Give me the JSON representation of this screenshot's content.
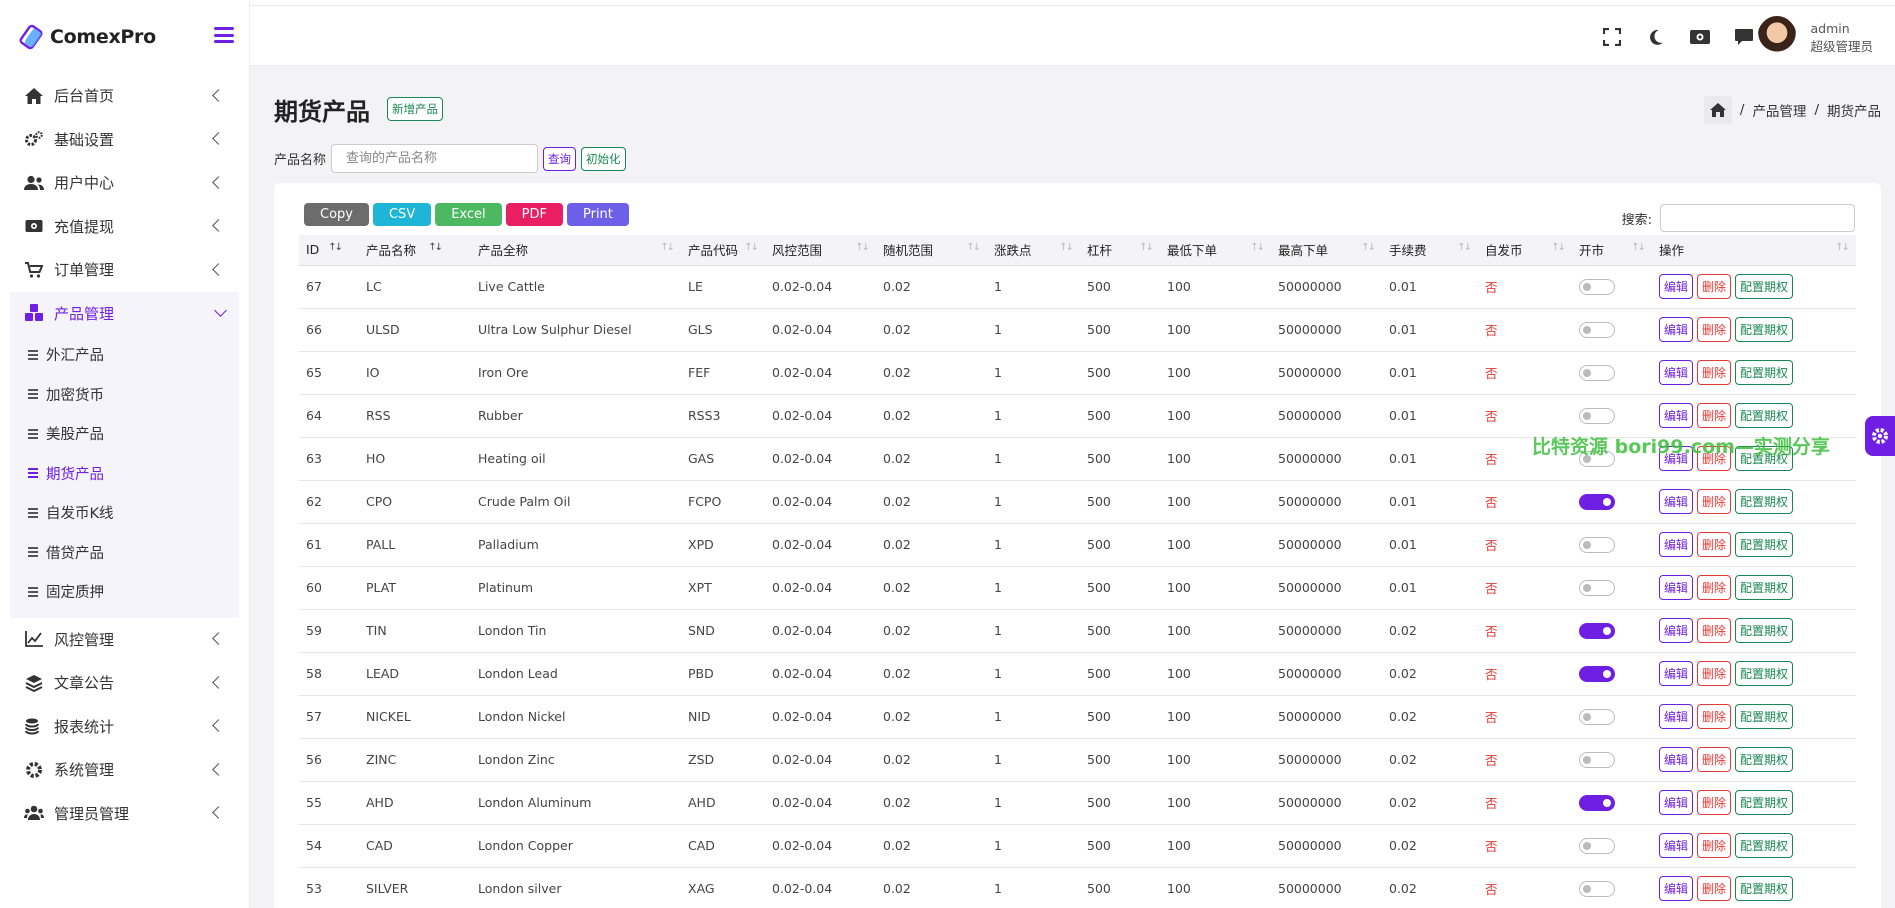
{
  "app": {
    "name": "ComexPro"
  },
  "sidebar": {
    "items": [
      {
        "label": "后台首页",
        "icon": "home-icon"
      },
      {
        "label": "基础设置",
        "icon": "gears-icon"
      },
      {
        "label": "用户中心",
        "icon": "users-icon"
      },
      {
        "label": "充值提现",
        "icon": "money-icon"
      },
      {
        "label": "订单管理",
        "icon": "cart-icon"
      },
      {
        "label": "产品管理",
        "icon": "cubes-icon",
        "active": true
      },
      {
        "label": "风控管理",
        "icon": "chart-line-icon"
      },
      {
        "label": "文章公告",
        "icon": "layers-icon"
      },
      {
        "label": "报表统计",
        "icon": "coins-icon"
      },
      {
        "label": "系统管理",
        "icon": "cog-icon"
      },
      {
        "label": "管理员管理",
        "icon": "user-group-icon"
      }
    ],
    "sub_items": [
      "外汇产品",
      "加密货币",
      "美股产品",
      "期货产品",
      "自发币K线",
      "借贷产品",
      "固定质押"
    ],
    "current_sub": "期货产品"
  },
  "topbar": {
    "icons": [
      "fullscreen-icon",
      "moon-icon",
      "money-icon",
      "chat-icon"
    ],
    "user": {
      "name": "admin",
      "role": "超级管理员"
    }
  },
  "page": {
    "title": "期货产品",
    "add_button": "新增产品",
    "breadcrumb": [
      "产品管理",
      "期货产品"
    ]
  },
  "filter": {
    "label": "产品名称",
    "placeholder": "查询的产品名称",
    "query_button": "查询",
    "reset_button": "初始化"
  },
  "export": {
    "buttons": [
      {
        "label": "Copy",
        "color": "#6c6c6c"
      },
      {
        "label": "CSV",
        "color": "#1fb5d6"
      },
      {
        "label": "Excel",
        "color": "#4cb962"
      },
      {
        "label": "PDF",
        "color": "#e91e63"
      },
      {
        "label": "Print",
        "color": "#6d5fe8"
      }
    ]
  },
  "search": {
    "label": "搜索:"
  },
  "table": {
    "columns": [
      "ID",
      "产品名称",
      "产品全称",
      "产品代码",
      "风控范围",
      "随机范围",
      "涨跌点",
      "杠杆",
      "最低下单",
      "最高下单",
      "手续费",
      "自发币",
      "开市",
      "操作"
    ],
    "ops": {
      "edit": "编辑",
      "delete": "删除",
      "config": "配置期权"
    },
    "rows": [
      {
        "id": "67",
        "name": "LC",
        "full": "Live Cattle",
        "code": "LE",
        "risk": "0.02-0.04",
        "rand": "0.02",
        "pts": "1",
        "lev": "500",
        "min": "100",
        "max": "50000000",
        "fee": "0.01",
        "self": "否",
        "open": false
      },
      {
        "id": "66",
        "name": "ULSD",
        "full": "Ultra Low Sulphur Diesel",
        "code": "GLS",
        "risk": "0.02-0.04",
        "rand": "0.02",
        "pts": "1",
        "lev": "500",
        "min": "100",
        "max": "50000000",
        "fee": "0.01",
        "self": "否",
        "open": false
      },
      {
        "id": "65",
        "name": "IO",
        "full": "Iron Ore",
        "code": "FEF",
        "risk": "0.02-0.04",
        "rand": "0.02",
        "pts": "1",
        "lev": "500",
        "min": "100",
        "max": "50000000",
        "fee": "0.01",
        "self": "否",
        "open": false
      },
      {
        "id": "64",
        "name": "RSS",
        "full": "Rubber",
        "code": "RSS3",
        "risk": "0.02-0.04",
        "rand": "0.02",
        "pts": "1",
        "lev": "500",
        "min": "100",
        "max": "50000000",
        "fee": "0.01",
        "self": "否",
        "open": false
      },
      {
        "id": "63",
        "name": "HO",
        "full": "Heating oil",
        "code": "GAS",
        "risk": "0.02-0.04",
        "rand": "0.02",
        "pts": "1",
        "lev": "500",
        "min": "100",
        "max": "50000000",
        "fee": "0.01",
        "self": "否",
        "open": false
      },
      {
        "id": "62",
        "name": "CPO",
        "full": "Crude Palm Oil",
        "code": "FCPO",
        "risk": "0.02-0.04",
        "rand": "0.02",
        "pts": "1",
        "lev": "500",
        "min": "100",
        "max": "50000000",
        "fee": "0.01",
        "self": "否",
        "open": true
      },
      {
        "id": "61",
        "name": "PALL",
        "full": "Palladium",
        "code": "XPD",
        "risk": "0.02-0.04",
        "rand": "0.02",
        "pts": "1",
        "lev": "500",
        "min": "100",
        "max": "50000000",
        "fee": "0.01",
        "self": "否",
        "open": false
      },
      {
        "id": "60",
        "name": "PLAT",
        "full": "Platinum",
        "code": "XPT",
        "risk": "0.02-0.04",
        "rand": "0.02",
        "pts": "1",
        "lev": "500",
        "min": "100",
        "max": "50000000",
        "fee": "0.01",
        "self": "否",
        "open": false
      },
      {
        "id": "59",
        "name": "TIN",
        "full": "London Tin",
        "code": "SND",
        "risk": "0.02-0.04",
        "rand": "0.02",
        "pts": "1",
        "lev": "500",
        "min": "100",
        "max": "50000000",
        "fee": "0.02",
        "self": "否",
        "open": true
      },
      {
        "id": "58",
        "name": "LEAD",
        "full": "London Lead",
        "code": "PBD",
        "risk": "0.02-0.04",
        "rand": "0.02",
        "pts": "1",
        "lev": "500",
        "min": "100",
        "max": "50000000",
        "fee": "0.02",
        "self": "否",
        "open": true
      },
      {
        "id": "57",
        "name": "NICKEL",
        "full": "London Nickel",
        "code": "NID",
        "risk": "0.02-0.04",
        "rand": "0.02",
        "pts": "1",
        "lev": "500",
        "min": "100",
        "max": "50000000",
        "fee": "0.02",
        "self": "否",
        "open": false
      },
      {
        "id": "56",
        "name": "ZINC",
        "full": "London Zinc",
        "code": "ZSD",
        "risk": "0.02-0.04",
        "rand": "0.02",
        "pts": "1",
        "lev": "500",
        "min": "100",
        "max": "50000000",
        "fee": "0.02",
        "self": "否",
        "open": false
      },
      {
        "id": "55",
        "name": "AHD",
        "full": "London Aluminum",
        "code": "AHD",
        "risk": "0.02-0.04",
        "rand": "0.02",
        "pts": "1",
        "lev": "500",
        "min": "100",
        "max": "50000000",
        "fee": "0.02",
        "self": "否",
        "open": true
      },
      {
        "id": "54",
        "name": "CAD",
        "full": "London Copper",
        "code": "CAD",
        "risk": "0.02-0.04",
        "rand": "0.02",
        "pts": "1",
        "lev": "500",
        "min": "100",
        "max": "50000000",
        "fee": "0.02",
        "self": "否",
        "open": false
      },
      {
        "id": "53",
        "name": "SILVER",
        "full": "London silver",
        "code": "XAG",
        "risk": "0.02-0.04",
        "rand": "0.02",
        "pts": "1",
        "lev": "500",
        "min": "100",
        "max": "50000000",
        "fee": "0.02",
        "self": "否",
        "open": false
      }
    ]
  },
  "watermark": "比特资源 bori99.com—实测分享",
  "colors": {
    "accent": "#6f1fe3",
    "success": "#198754",
    "danger": "#e53935"
  }
}
